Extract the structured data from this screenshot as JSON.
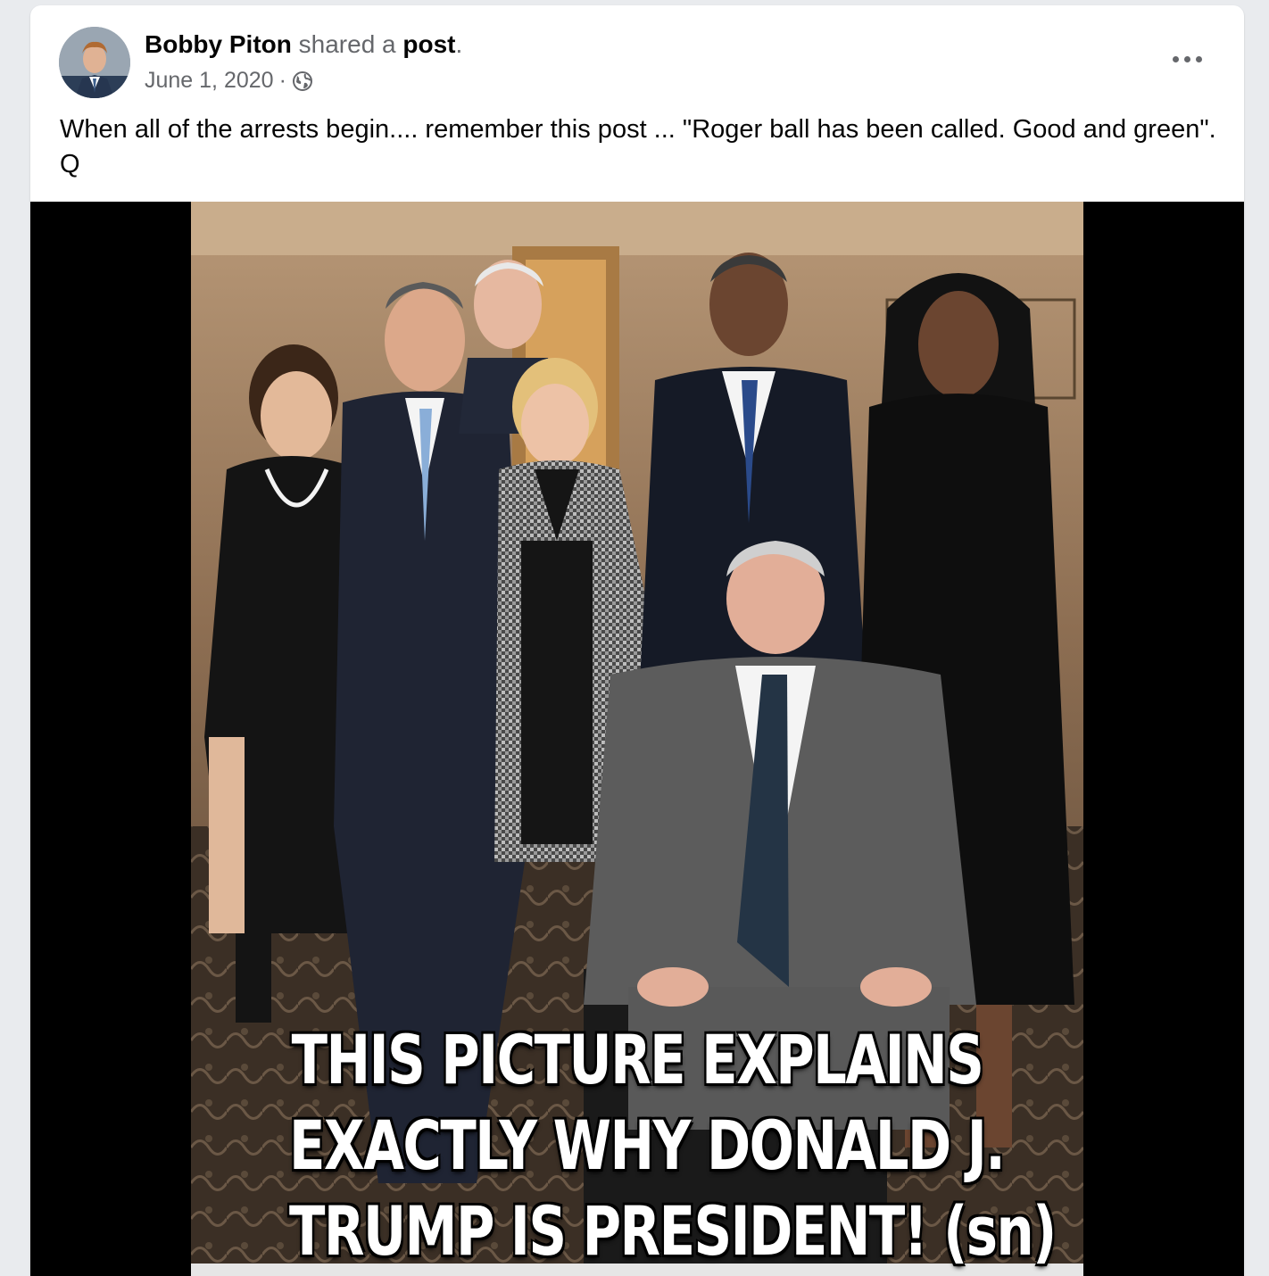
{
  "post": {
    "author": "Bobby Piton",
    "shared_text": "shared a",
    "post_link": "post",
    "period": ".",
    "date": "June 1, 2020",
    "separator": "·",
    "privacy_icon": "globe-icon",
    "more_icon": "more-options-icon",
    "body": "When all of the arrests begin.... remember this post ... \"Roger ball has been called.  Good and green\".  Q"
  },
  "image": {
    "caption_lines": [
      "THIS PICTURE EXPLAINS",
      "EXACTLY WHY DONALD J.",
      "TRUMP IS PRESIDENT!  (sn)"
    ]
  },
  "colors": {
    "page_bg": "#e9ebee",
    "card_bg": "#ffffff",
    "text_primary": "#050505",
    "text_secondary": "#65676b",
    "media_bg": "#000000"
  }
}
